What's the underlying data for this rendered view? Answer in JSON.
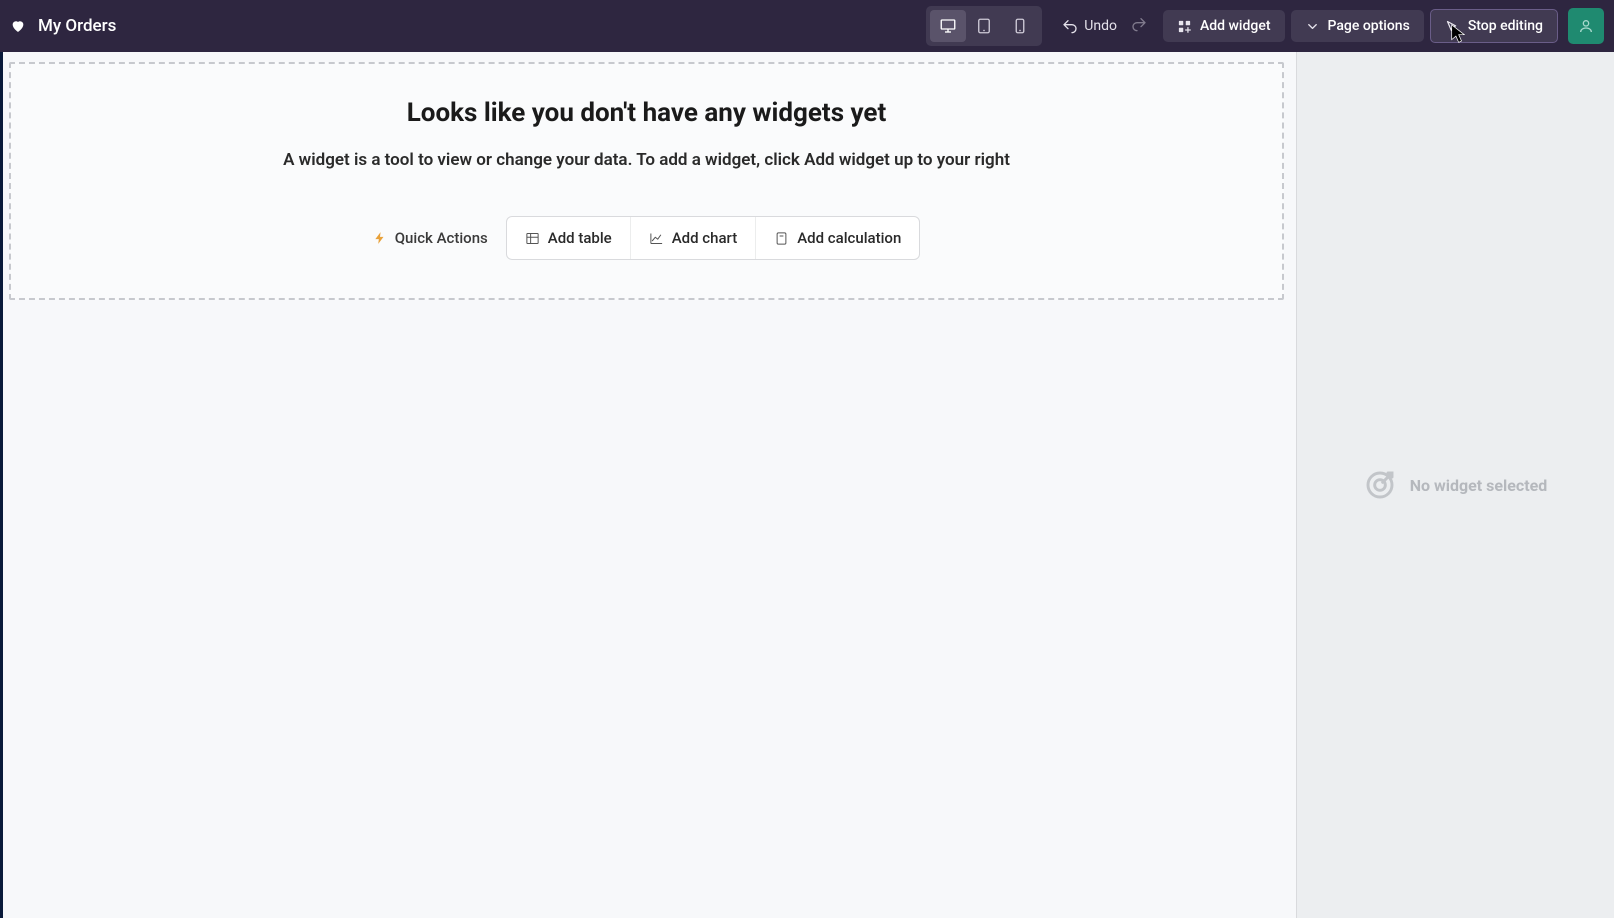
{
  "header": {
    "page_title": "My Orders",
    "undo_label": "Undo",
    "add_widget_label": "Add widget",
    "page_options_label": "Page options",
    "stop_editing_label": "Stop editing"
  },
  "empty_state": {
    "title": "Looks like you don't have any widgets yet",
    "subtitle": "A widget is a tool to view or change your data. To add a widget, click Add widget up to your right",
    "quick_actions_label": "Quick Actions",
    "add_table_label": "Add table",
    "add_chart_label": "Add chart",
    "add_calculation_label": "Add calculation"
  },
  "sidepanel": {
    "no_widget_text": "No widget selected"
  }
}
